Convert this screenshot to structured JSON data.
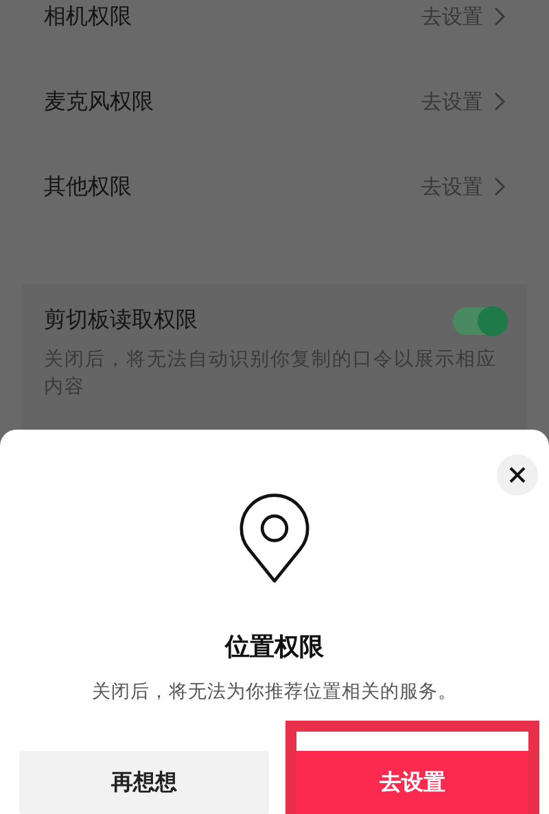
{
  "permissions": [
    {
      "label": "相机权限",
      "action": "去设置"
    },
    {
      "label": "麦克风权限",
      "action": "去设置"
    },
    {
      "label": "其他权限",
      "action": "去设置"
    }
  ],
  "clipboard": {
    "label": "剪切板读取权限",
    "on": true,
    "description": "关闭后，将无法自动识别你复制的口令以展示相应内容"
  },
  "dialog": {
    "title": "位置权限",
    "message": "关闭后，将无法为你推荐位置相关的服务。",
    "cancel": "再想想",
    "confirm": "去设置",
    "confirm_highlighted": true
  }
}
